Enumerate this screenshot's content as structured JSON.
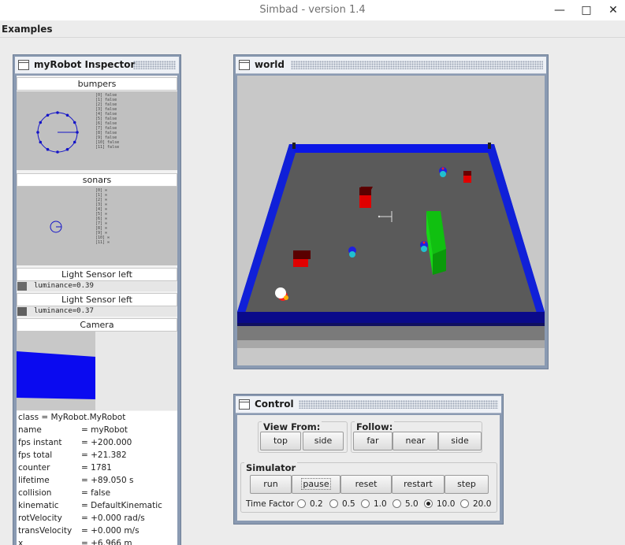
{
  "app": {
    "title": "Simbad  - version 1.4"
  },
  "menu": {
    "items": [
      {
        "label": "Examples"
      }
    ]
  },
  "inspector": {
    "title": "myRobot Inspector",
    "bumpers": {
      "title": "bumpers",
      "lines": [
        "[0] false",
        "[1] false",
        "[2] false",
        "[3] false",
        "[4] false",
        "[5] false",
        "[6] false",
        "[7] false",
        "[8] false",
        "[9] false",
        "[10] false",
        "[11] false"
      ]
    },
    "sonars": {
      "title": "sonars",
      "lines": [
        "[0] ∞",
        "[1] ∞",
        "[2] ∞",
        "[3] ∞",
        "[4] ∞",
        "[5] ∞",
        "[6] ∞",
        "[7] ∞",
        "[8] ∞",
        "[9] ∞",
        "[10] ∞",
        "[11] ∞"
      ]
    },
    "light_left_1": {
      "title": "Light Sensor left",
      "value": "luminance=0.39"
    },
    "light_left_2": {
      "title": "Light Sensor left",
      "value": "luminance=0.37"
    },
    "camera": {
      "title": "Camera"
    },
    "class_line": "class = MyRobot.MyRobot",
    "properties": [
      {
        "key": "name",
        "value": "= myRobot"
      },
      {
        "key": "fps instant",
        "value": "= +200.000"
      },
      {
        "key": "fps total",
        "value": "= +21.382"
      },
      {
        "key": "counter",
        "value": "= 1781"
      },
      {
        "key": "lifetime",
        "value": "= +89.050 s"
      },
      {
        "key": "collision",
        "value": "= false"
      },
      {
        "key": "kinematic",
        "value": "= DefaultKinematic"
      },
      {
        "key": "rotVelocity",
        "value": "= +0.000 rad/s"
      },
      {
        "key": "transVelocity",
        "value": "= +0.000 m/s"
      },
      {
        "key": "x",
        "value": "= +6.966 m"
      }
    ]
  },
  "world": {
    "title": "world"
  },
  "control": {
    "title": "Control",
    "view_from": {
      "label": "View From:",
      "buttons": [
        "top",
        "side"
      ]
    },
    "follow": {
      "label": "Follow:",
      "buttons": [
        "far",
        "near",
        "side"
      ]
    },
    "simulator": {
      "label": "Simulator",
      "buttons": [
        "run",
        "pause",
        "reset",
        "restart",
        "step"
      ]
    },
    "time_factor": {
      "label": "Time Factor",
      "options": [
        "0.2",
        "0.5",
        "1.0",
        "5.0",
        "10.0",
        "20.0"
      ],
      "selected": "10.0"
    }
  },
  "colors": {
    "frame": "#8a9ab2",
    "wall_blue": "#0a16e6",
    "floor": "#5a5a5a",
    "box_red": "#e00000",
    "obstacle_green": "#10c010"
  }
}
